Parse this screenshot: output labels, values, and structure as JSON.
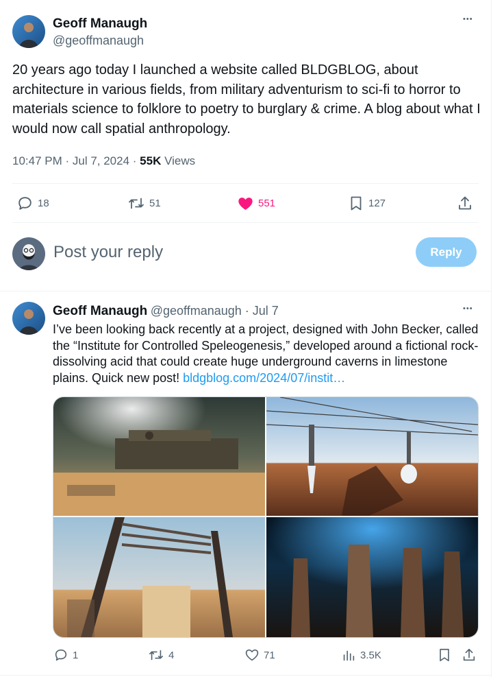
{
  "main_tweet": {
    "author_name": "Geoff Manaugh",
    "author_handle": "@geoffmanaugh",
    "more_label": "•••",
    "text": "20 years ago today I launched a website called BLDGBLOG, about architecture in various fields, from military adventurism to sci-fi to horror to materials science to folklore to poetry to burglary & crime. A blog about what I would now call spatial anthropology.",
    "time": "10:47 PM · Jul 7, 2024 · ",
    "views_count": "55K",
    "views_label": " Views",
    "replies": "18",
    "reposts": "51",
    "likes": "551",
    "bookmarks": "127"
  },
  "reply_composer": {
    "placeholder": "Post your reply",
    "button_label": "Reply"
  },
  "thread_tweet": {
    "author_name": "Geoff Manaugh",
    "author_handle": "@geoffmanaugh",
    "date": " · Jul 7",
    "more_label": "•••",
    "text": "I’ve been looking back recently at a project, designed with John Becker, called the “Institute for Controlled Speleogenesis,” developed around a fictional rock-dissolving acid that could create huge underground caverns in limestone plains. Quick new post! ",
    "link": "bldgblog.com/2024/07/instit…",
    "replies": "1",
    "reposts": "4",
    "likes": "71",
    "views": "3.5K"
  },
  "colors": {
    "like_active": "#f91880",
    "link": "#1d9bf0",
    "secondary_text": "#536471",
    "reply_button": "#8ecdf8"
  }
}
